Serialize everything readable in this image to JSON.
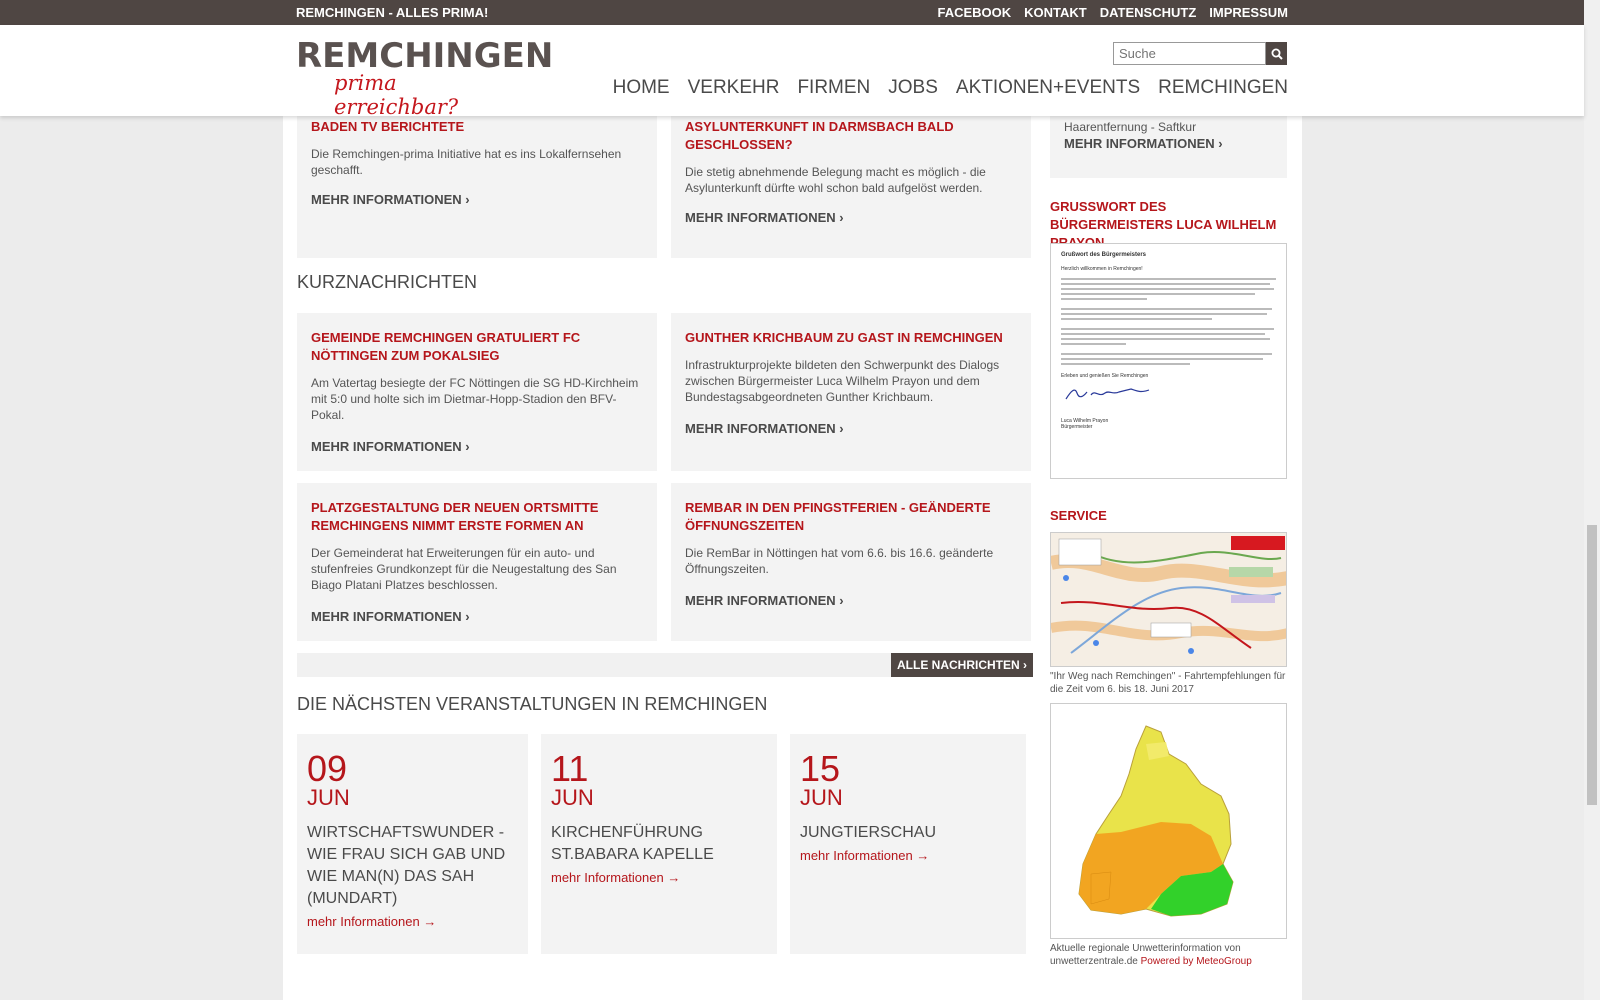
{
  "topbar": {
    "brand": "REMCHINGEN - ALLES PRIMA!",
    "links": [
      "FACEBOOK",
      "KONTAKT",
      "DATENSCHUTZ",
      "IMPRESSUM"
    ]
  },
  "header": {
    "logo_word": "REMCHINGEN",
    "logo_tag": "prima erreichbar?",
    "search_placeholder": "Suche",
    "nav": [
      "HOME",
      "VERKEHR",
      "FIRMEN",
      "JOBS",
      "AKTIONEN+EVENTS",
      "REMCHINGEN"
    ]
  },
  "top_news": [
    {
      "title": "BADEN TV BERICHTETE",
      "text": "Die Remchingen-prima Initiative hat es ins Lokalfernsehen geschafft.",
      "more": "MEHR INFORMATIONEN ›"
    },
    {
      "title": "ASYLUNTERKUNFT IN DARMSBACH BALD GESCHLOSSEN?",
      "text": "Die stetig abnehmende Belegung macht es möglich - die Asylunterkunft dürfte wohl schon bald aufgelöst werden.",
      "more": "MEHR INFORMATIONEN ›"
    }
  ],
  "kurz": {
    "heading": "KURZNACHRICHTEN",
    "items": [
      {
        "title": "GEMEINDE REMCHINGEN GRATULIERT FC NÖTTINGEN ZUM POKALSIEG",
        "text": "Am Vatertag besiegte der FC Nöttingen die SG HD-Kirchheim mit 5:0 und holte sich im Dietmar-Hopp-Stadion den BFV-Pokal.",
        "more": "MEHR INFORMATIONEN ›"
      },
      {
        "title": "GUNTHER KRICHBAUM ZU GAST IN REMCHINGEN",
        "text": "Infrastrukturprojekte bildeten den Schwerpunkt des Dialogs zwischen Bürgermeister Luca Wilhelm Prayon und dem Bundestagsabgeordneten Gunther Krichbaum.",
        "more": "MEHR INFORMATIONEN ›"
      },
      {
        "title": "PLATZGESTALTUNG DER NEUEN ORTSMITTE REMCHINGENS NIMMT ERSTE FORMEN AN",
        "text": "Der Gemeinderat hat Erweiterungen für ein auto- und stufenfreies Grundkonzept für die Neugestaltung des San Biago Platani Platzes beschlossen.",
        "more": "MEHR INFORMATIONEN ›"
      },
      {
        "title": "REMBAR IN DEN PFINGSTFERIEN - GEÄNDERTE ÖFFNUNGSZEITEN",
        "text": "Die RemBar in Nöttingen hat vom 6.6. bis 16.6. geänderte Öffnungszeiten.",
        "more": "MEHR INFORMATIONEN ›"
      }
    ],
    "all_button": "ALLE NACHRICHTEN ›"
  },
  "events": {
    "heading": "DIE NÄCHSTEN VERANSTALTUNGEN IN REMCHINGEN",
    "items": [
      {
        "day": "09",
        "month": "JUN",
        "title": "WIRTSCHAFTSWUNDER - WIE FRAU SICH GAB UND WIE MAN(N) DAS SAH (MUNDART)",
        "more": "mehr Informationen →"
      },
      {
        "day": "11",
        "month": "JUN",
        "title": "KIRCHENFÜHRUNG ST.BABARA KAPELLE",
        "more": "mehr Informationen →"
      },
      {
        "day": "15",
        "month": "JUN",
        "title": "JUNGTIERSCHAU",
        "more": "mehr Informationen →"
      }
    ]
  },
  "sidebar": {
    "top_text": "Haarentfernung - Saftkur",
    "top_more": "MEHR INFORMATIONEN ›",
    "greeting_heading": "GRUSSWORT DES BÜRGERMEISTERS LUCA WILHELM PRAYON",
    "letter": {
      "title": "Grußwort des Bürgermeisters",
      "salutation": "Herzlich willkommen in Remchingen!",
      "closing": "Erleben und genießen Sie Remchingen",
      "name": "Luca Wilhelm Prayon",
      "role": "Bürgermeister"
    },
    "service_heading": "SERVICE",
    "map_caption": "\"Ihr Weg nach Remchingen\" - Fahrtempfehlungen für die Zeit vom 6. bis 18. Juni 2017",
    "weather_caption": "Aktuelle regionale Unwetterinformation von unwetterzentrale.de",
    "weather_powered": "Powered by MeteoGroup"
  },
  "colors": {
    "accent": "#b5161b",
    "dark": "#4f4643",
    "card": "#f3f3f3"
  }
}
